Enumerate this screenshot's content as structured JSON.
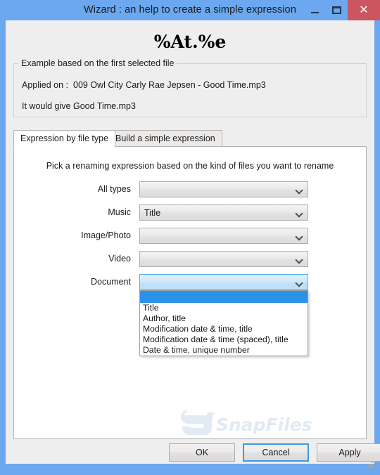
{
  "window": {
    "title": "Wizard : an help to create a simple expression",
    "controls": {
      "minimize": "–",
      "maximize": "□",
      "close": "✕"
    }
  },
  "expression": {
    "value": "%At.%e"
  },
  "example_group": {
    "legend": "Example based on the first selected file",
    "applied_on_label": "Applied on :",
    "applied_on_value": "009 Owl City  Carly Rae Jepsen - Good Time.mp3",
    "would_give_label": "It would give :",
    "would_give_value": "Good Time.mp3"
  },
  "tabs": [
    {
      "label": "Expression by file type",
      "active": true
    },
    {
      "label": "Build a simple expression",
      "active": false
    }
  ],
  "panel": {
    "instruction": "Pick a renaming expression based on the kind of files you want to rename",
    "rows": [
      {
        "label": "All types",
        "value": ""
      },
      {
        "label": "Music",
        "value": "Title"
      },
      {
        "label": "Image/Photo",
        "value": ""
      },
      {
        "label": "Video",
        "value": ""
      },
      {
        "label": "Document",
        "value": ""
      }
    ]
  },
  "document_dropdown": {
    "open": true,
    "selected": "",
    "options": [
      "Title",
      "Author, title",
      "Modification date & time, title",
      "Modification date & time (spaced), title",
      "Date & time, unique number"
    ]
  },
  "watermark": {
    "text": "SnapFiles"
  },
  "footer": {
    "ok": "OK",
    "cancel": "Cancel",
    "apply": "Apply"
  },
  "colors": {
    "frame_blue": "#6ba8ef",
    "close_red": "#cc5562",
    "highlight_blue": "#2a93e8",
    "focus_blue": "#3c9bdf",
    "client_bg": "#efeeee"
  }
}
